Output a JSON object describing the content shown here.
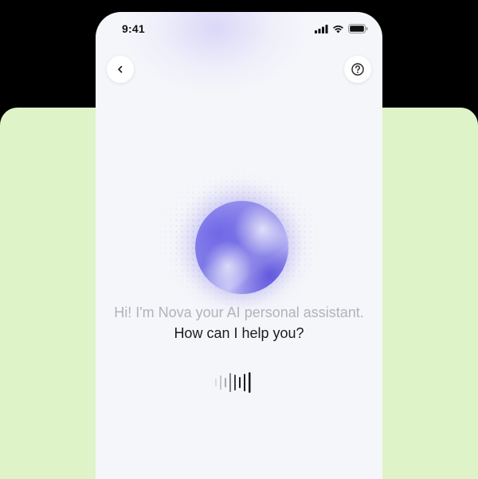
{
  "status_bar": {
    "time": "9:41",
    "icons": [
      "signal-icon",
      "wifi-icon",
      "battery-icon"
    ]
  },
  "header": {
    "back_icon": "chevron-left-icon",
    "help_icon": "question-circle-icon"
  },
  "assistant": {
    "orb_icon": "assistant-orb",
    "message_intro": "Hi! I'm Nova your AI personal assistant.",
    "message_question": "How can I help you?"
  },
  "voice": {
    "icon": "voice-waveform-icon"
  },
  "colors": {
    "background_card": "#dff3c8",
    "phone_bg": "#f5f6fa",
    "orb_accent": "#7f7ae6",
    "text_muted": "#b2b3ba",
    "text_strong": "#1b1b22"
  }
}
